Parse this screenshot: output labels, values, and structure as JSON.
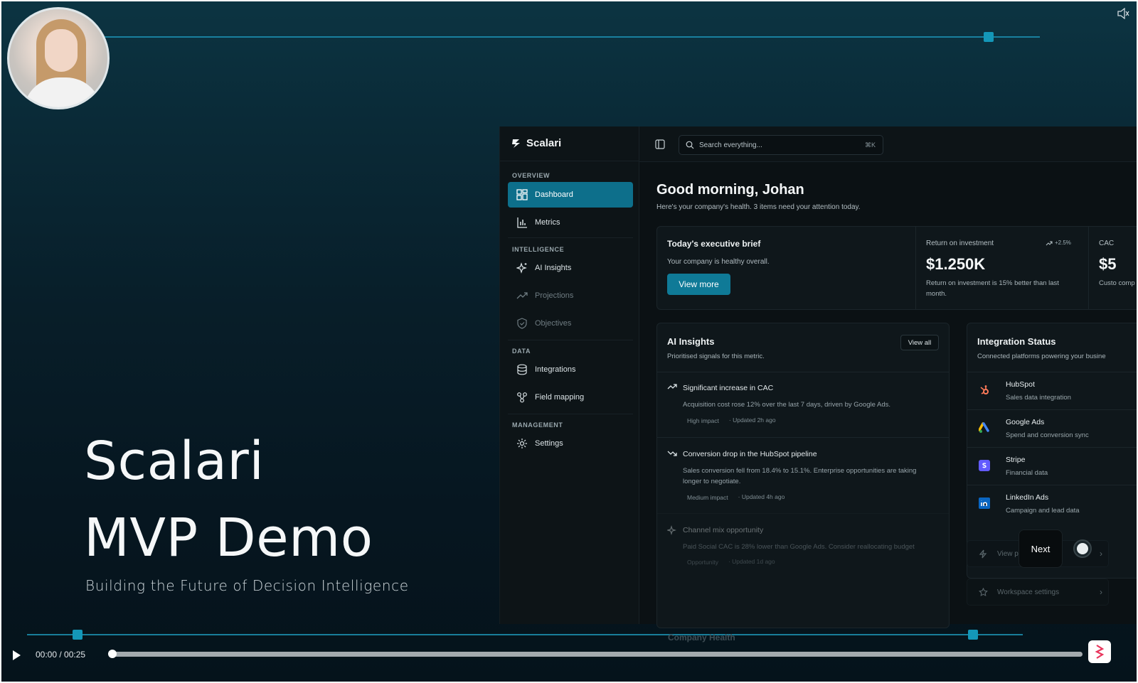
{
  "hero": {
    "title_line1": "Scalari",
    "title_line2": "MVP Demo",
    "subtitle": "Building the Future of Decision Intelligence"
  },
  "app": {
    "brand": "Scalari",
    "search": {
      "placeholder": "Search everything...",
      "shortcut": "⌘K"
    },
    "sidebar": {
      "sections": [
        {
          "label": "OVERVIEW",
          "items": [
            {
              "label": "Dashboard",
              "icon": "dashboard-icon",
              "active": true
            },
            {
              "label": "Metrics",
              "icon": "bar-chart-icon"
            }
          ]
        },
        {
          "label": "INTELLIGENCE",
          "items": [
            {
              "label": "AI Insights",
              "icon": "sparkles-icon"
            },
            {
              "label": "Projections",
              "icon": "trend-up-icon",
              "dim": true
            },
            {
              "label": "Objectives",
              "icon": "shield-icon",
              "dim": true
            }
          ]
        },
        {
          "label": "DATA",
          "items": [
            {
              "label": "Integrations",
              "icon": "database-icon"
            },
            {
              "label": "Field mapping",
              "icon": "mapping-icon"
            }
          ]
        },
        {
          "label": "MANAGEMENT",
          "items": [
            {
              "label": "Settings",
              "icon": "gear-icon"
            }
          ]
        }
      ]
    },
    "greeting": "Good morning, Johan",
    "greeting_sub": "Here's your company's health. 3 items need your attention today.",
    "brief": {
      "title": "Today's executive brief",
      "subtitle": "Your company is healthy overall.",
      "button": "View more",
      "roi": {
        "label": "Return on investment",
        "delta": "+2.5%",
        "value": "$1.250K",
        "note": "Return on investment is 15% better than last month."
      },
      "cac": {
        "label": "CAC",
        "value": "$5",
        "note": "Custo comp"
      }
    },
    "insights": {
      "title": "AI Insights",
      "subtitle": "Prioritised signals for this metric.",
      "view_all": "View all",
      "items": [
        {
          "title": "Significant increase in CAC",
          "desc": "Acquisition cost rose 12% over the last 7 days, driven by Google Ads.",
          "impact": "High impact",
          "updated": "· Updated 2h ago",
          "icon": "trend-up-icon"
        },
        {
          "title": "Conversion drop in the HubSpot pipeline",
          "desc": "Sales conversion fell from 18.4% to 15.1%. Enterprise opportunities are taking longer to negotiate.",
          "impact": "Medium impact",
          "updated": "· Updated 4h ago",
          "icon": "trend-down-icon"
        },
        {
          "title": "Channel mix opportunity",
          "desc": "Paid Social CAC is 28% lower than Google Ads. Consider reallocating budget",
          "impact": "Opportunity",
          "updated": "· Updated 1d ago",
          "icon": "sparkles-icon"
        }
      ]
    },
    "integrations": {
      "title": "Integration Status",
      "subtitle": "Connected platforms powering your busine",
      "items": [
        {
          "name": "HubSpot",
          "desc": "Sales data integration",
          "color": "#ff7a59"
        },
        {
          "name": "Google Ads",
          "desc": "Spend and conversion sync",
          "color": "#4285f4"
        },
        {
          "name": "Stripe",
          "desc": "Financial data",
          "color": "#635bff"
        },
        {
          "name": "LinkedIn Ads",
          "desc": "Campaign and lead data",
          "color": "#0a66c2"
        }
      ]
    },
    "quick_links": [
      {
        "label": "View p"
      },
      {
        "label": "Workspace settings"
      }
    ],
    "company_health": "Company Health"
  },
  "tour": {
    "next_label": "Next"
  },
  "player": {
    "time": "00:00 / 00:25",
    "progress": 0
  },
  "colors": {
    "accent": "#0d6f8b",
    "line": "#1b8aa8",
    "background": "#081e29"
  }
}
